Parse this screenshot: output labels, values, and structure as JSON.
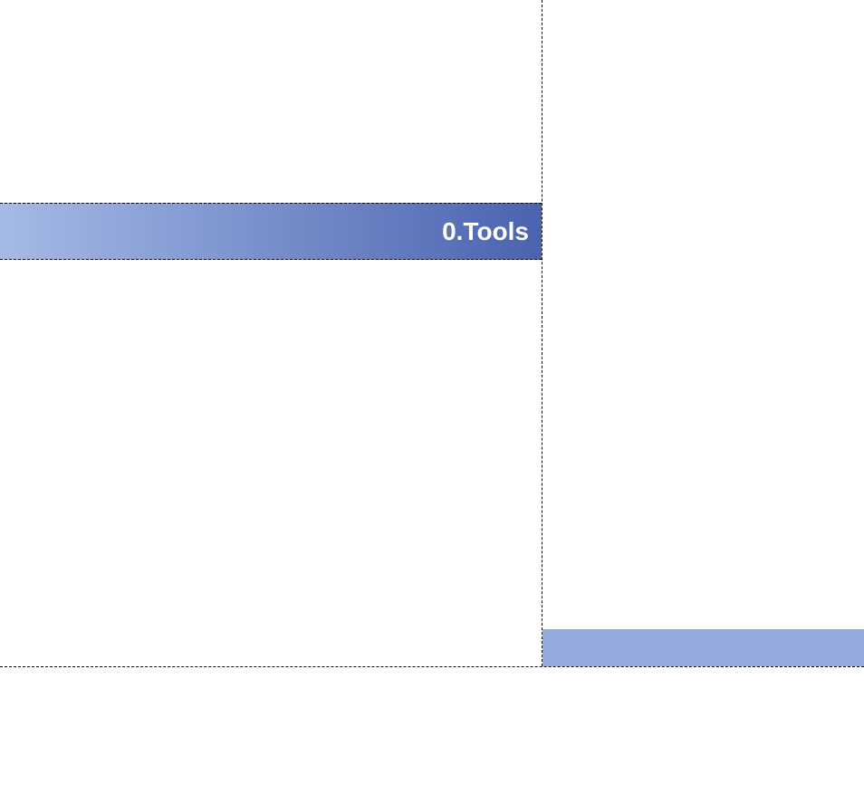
{
  "left_cell": {
    "title": "0.Tools"
  },
  "colors": {
    "gradient_start": "#a6bae6",
    "gradient_end": "#4a63b0",
    "right_bar": "#95abdd",
    "dash": "#000000",
    "title_text": "#ffffff"
  }
}
